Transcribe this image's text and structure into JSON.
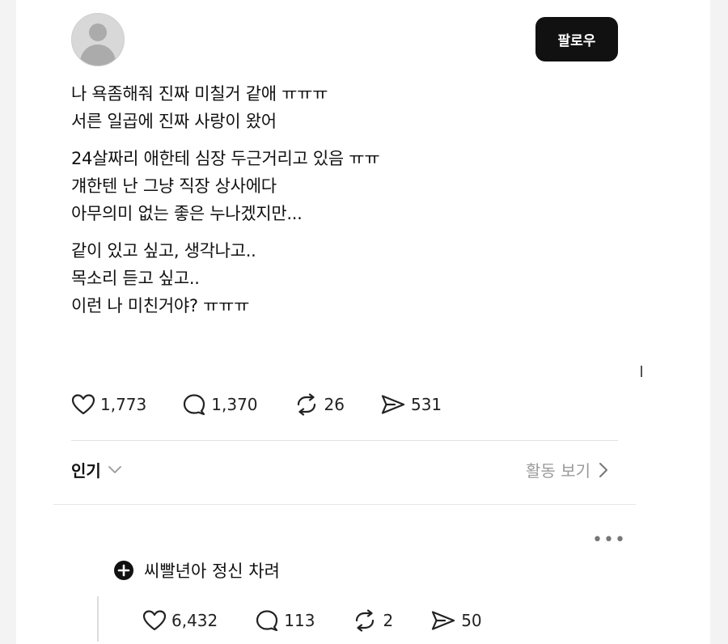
{
  "post": {
    "follow_label": "팔로우",
    "paragraphs": [
      [
        "나 욕좀해줘 진짜 미칠거 같애 ㅠㅠㅠ",
        "서른 일곱에 진짜 사랑이 왔어"
      ],
      [
        "24살짜리 애한테 심장 두근거리고 있음 ㅠㅠ",
        "걔한텐 난 그냥 직장 상사에다",
        "아무의미 없는 좋은 누나겠지만..."
      ],
      [
        "같이 있고 싶고, 생각나고..",
        "목소리 듣고 싶고..",
        "이런 나 미친거야? ㅠㅠㅠ"
      ]
    ],
    "stats": {
      "likes": "1,773",
      "replies": "1,370",
      "reposts": "26",
      "shares": "531"
    }
  },
  "sort": {
    "label": "인기",
    "activity_label": "활동 보기"
  },
  "reply": {
    "text": "씨빨년아 정신 차려",
    "stats": {
      "likes": "6,432",
      "replies": "113",
      "reposts": "2",
      "shares": "50"
    }
  },
  "icons": [
    "avatar-placeholder",
    "heart-icon",
    "comment-icon",
    "repost-icon",
    "share-icon",
    "chevron-down-icon",
    "chevron-right-icon",
    "more-icon",
    "plus-circle-icon"
  ]
}
